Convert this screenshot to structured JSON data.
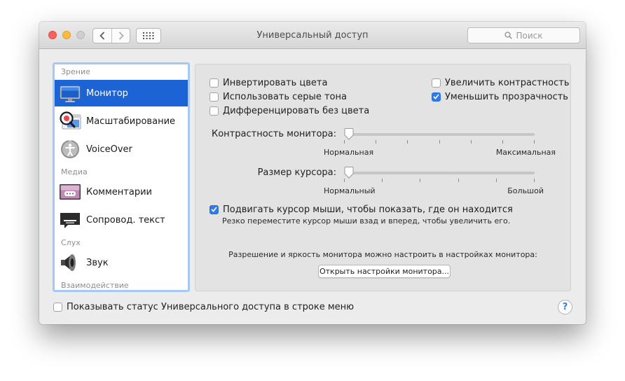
{
  "window": {
    "title": "Универсальный доступ"
  },
  "toolbar": {
    "search_placeholder": "Поиск",
    "search_icon": "magnifier-icon"
  },
  "sidebar": {
    "headers": {
      "vision": "Зрение",
      "media": "Медиа",
      "hearing": "Слух",
      "interaction": "Взаимодействие"
    },
    "items": [
      {
        "label": "Монитор",
        "icon": "display-icon",
        "selected": true
      },
      {
        "label": "Масштабирование",
        "icon": "zoom-icon",
        "selected": false
      },
      {
        "label": "VoiceOver",
        "icon": "voiceover-icon",
        "selected": false
      },
      {
        "label": "Комментарии",
        "icon": "descriptions-icon",
        "selected": false
      },
      {
        "label": "Сопровод. текст",
        "icon": "captions-icon",
        "selected": false
      },
      {
        "label": "Звук",
        "icon": "speaker-icon",
        "selected": false
      }
    ]
  },
  "options": {
    "invert_colors": {
      "label": "Инвертировать цвета",
      "checked": false
    },
    "grayscale": {
      "label": "Использовать серые тона",
      "checked": false
    },
    "differentiate": {
      "label": "Дифференцировать без цвета",
      "checked": false
    },
    "increase_contrast": {
      "label": "Увеличить контрастность",
      "checked": false
    },
    "reduce_transparency": {
      "label": "Уменьшить прозрачность",
      "checked": true
    }
  },
  "contrast": {
    "label": "Контрастность монитора:",
    "min_label": "Нормальная",
    "max_label": "Максимальная",
    "value": 0,
    "ticks": 7
  },
  "cursor": {
    "label": "Размер курсора:",
    "min_label": "Нормальный",
    "max_label": "Большой",
    "value": 0,
    "ticks": 6
  },
  "shake": {
    "label": "Подвигать курсор мыши, чтобы показать, где он находится",
    "checked": true,
    "hint": "Резко переместите курсор мыши взад и вперед, чтобы увеличить его."
  },
  "display_note": "Разрешение и яркость монитора можно настроить в настройках монитора:",
  "display_button": "Открыть настройки монитора...",
  "menubar_status": {
    "label": "Показывать статус Универсального доступа в строке меню",
    "checked": false
  },
  "help": "?",
  "colors": {
    "accent": "#1c63d6",
    "check": "#2f7bea",
    "sidebar_focus": "#a6c8f5",
    "close": "#fc605c",
    "minimize": "#fdbc40"
  }
}
